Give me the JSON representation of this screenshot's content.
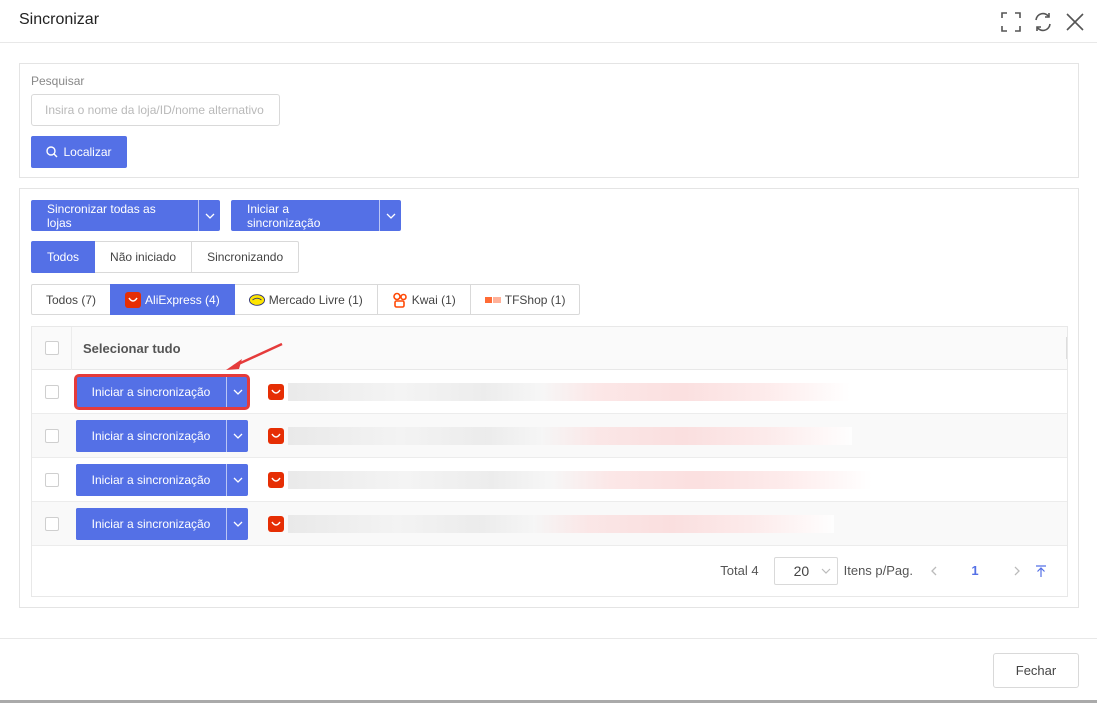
{
  "dialog": {
    "title": "Sincronizar"
  },
  "search": {
    "label": "Pesquisar",
    "placeholder": "Insira o nome da loja/ID/nome alternativo",
    "value": "",
    "button": "Localizar"
  },
  "toolbar": {
    "sync_all": "Sincronizar todas as lojas",
    "start_sync": "Iniciar a sincronização"
  },
  "status_filter": [
    "Todos",
    "Não iniciado",
    "Sincronizando"
  ],
  "platform_tabs": [
    {
      "label": "Todos (7)",
      "icon": ""
    },
    {
      "label": "AliExpress (4)",
      "icon": "aliexpress-icon"
    },
    {
      "label": "Mercado Livre (1)",
      "icon": "mercado-livre-icon"
    },
    {
      "label": "Kwai (1)",
      "icon": "kwai-icon"
    },
    {
      "label": "TFShop (1)",
      "icon": "tfshop-icon"
    }
  ],
  "table": {
    "select_all": "Selecionar tudo",
    "rows": [
      {
        "action": "Iniciar a sincronização",
        "store_icon": "aliexpress-icon"
      },
      {
        "action": "Iniciar a sincronização",
        "store_icon": "aliexpress-icon"
      },
      {
        "action": "Iniciar a sincronização",
        "store_icon": "aliexpress-icon"
      },
      {
        "action": "Iniciar a sincronização",
        "store_icon": "aliexpress-icon"
      }
    ]
  },
  "pagination": {
    "total": "Total 4",
    "page_size": "20",
    "per_page_label": "Itens p/Pag.",
    "current_page": "1"
  },
  "footer": {
    "close": "Fechar"
  },
  "colors": {
    "primary": "#5470e6",
    "highlight": "#e53b3b",
    "aliexpress": "#e62e04"
  }
}
